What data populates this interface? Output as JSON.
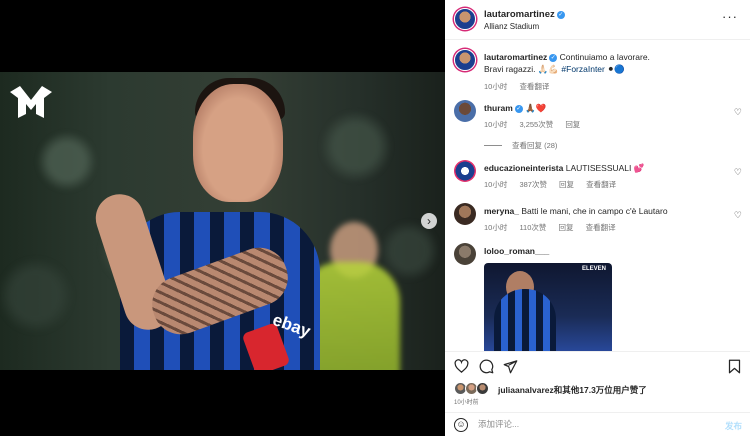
{
  "post": {
    "username": "lautaromartinez",
    "location": "Allianz Stadium",
    "caption_line1": "Continuiamo a lavorare.",
    "caption_line2": "Bravi ragazzi. 🙏🏻💪🏻",
    "caption_tag": "#ForzaInter",
    "caption_end": "⚫🔵",
    "caption_time": "10小时",
    "caption_translate": "查看翻译",
    "sponsor_text": "ebay",
    "post_time": "10小时前",
    "likes_text": "juliaanalvarez和其他17.3万位用户赞了",
    "photo_dots": 4,
    "photo_active_dot": 1
  },
  "comments": [
    {
      "user": "thuram",
      "text": "🙏🏾❤️",
      "time": "10小时",
      "likes": "3,255次赞",
      "reply": "回复",
      "view_replies": "查看回复 (28)"
    },
    {
      "user": "educazioneinterista",
      "text": "LAUTISESSUALI 💕",
      "time": "10小时",
      "likes": "387次赞",
      "reply": "回复",
      "translate": "查看翻译"
    },
    {
      "user": "meryna_",
      "text": "Batti le mani, che in campo c'è Lautaro",
      "time": "10小时",
      "likes": "110次赞",
      "reply": "回复",
      "translate": "查看翻译"
    },
    {
      "user": "loloo_roman___",
      "thumb_brand": "ELEVEN"
    }
  ],
  "composer": {
    "placeholder": "添加评论...",
    "post_label": "发布"
  },
  "icons": {
    "more": "more-icon",
    "heart": "heart-icon",
    "comment": "comment-icon",
    "share": "share-icon",
    "save": "bookmark-icon",
    "emoji": "emoji-icon",
    "next": "chevron-right-icon"
  },
  "colors": {
    "verified": "#3897f0",
    "tag": "#00376b",
    "muted": "#737373",
    "post_button": "#b2dffc"
  }
}
